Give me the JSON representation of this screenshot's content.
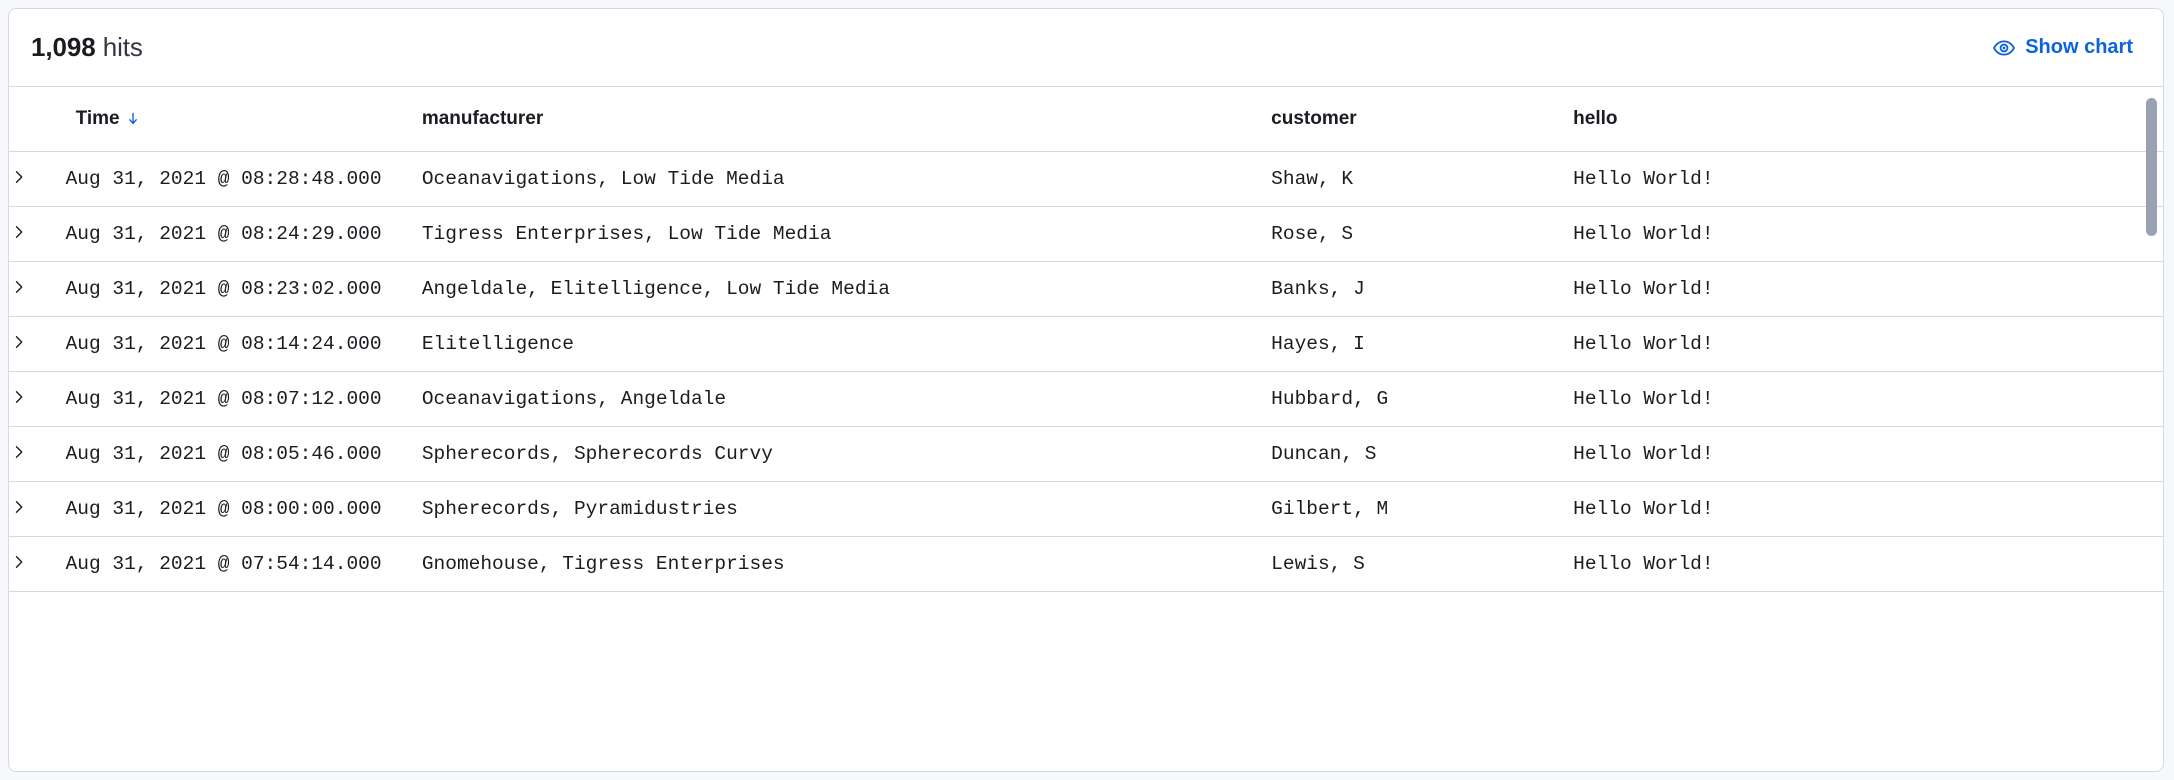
{
  "panel": {
    "hits_count": "1,098",
    "hits_word": "hits",
    "show_chart_label": "Show chart",
    "accent_color": "#0b64dd",
    "border_color": "#d3dae6",
    "text_color": "#1a1c21",
    "eye_icon": "eye-icon",
    "sort_icon": "arrow-down-icon",
    "expand_icon": "chevron-right-icon"
  },
  "table": {
    "columns": [
      {
        "key": "time",
        "label": "Time",
        "sorted": "desc"
      },
      {
        "key": "manufacturer",
        "label": "manufacturer",
        "sorted": ""
      },
      {
        "key": "customer",
        "label": "customer",
        "sorted": ""
      },
      {
        "key": "hello",
        "label": "hello",
        "sorted": ""
      }
    ],
    "rows": [
      {
        "time": "Aug 31, 2021 @ 08:28:48.000",
        "manufacturer": "Oceanavigations, Low Tide Media",
        "customer": "Shaw, K",
        "hello": "Hello World!"
      },
      {
        "time": "Aug 31, 2021 @ 08:24:29.000",
        "manufacturer": "Tigress Enterprises, Low Tide Media",
        "customer": "Rose, S",
        "hello": "Hello World!"
      },
      {
        "time": "Aug 31, 2021 @ 08:23:02.000",
        "manufacturer": "Angeldale, Elitelligence, Low Tide Media",
        "customer": "Banks, J",
        "hello": "Hello World!"
      },
      {
        "time": "Aug 31, 2021 @ 08:14:24.000",
        "manufacturer": "Elitelligence",
        "customer": "Hayes, I",
        "hello": "Hello World!"
      },
      {
        "time": "Aug 31, 2021 @ 08:07:12.000",
        "manufacturer": "Oceanavigations, Angeldale",
        "customer": "Hubbard, G",
        "hello": "Hello World!"
      },
      {
        "time": "Aug 31, 2021 @ 08:05:46.000",
        "manufacturer": "Spherecords, Spherecords Curvy",
        "customer": "Duncan, S",
        "hello": "Hello World!"
      },
      {
        "time": "Aug 31, 2021 @ 08:00:00.000",
        "manufacturer": "Spherecords, Pyramidustries",
        "customer": "Gilbert, M",
        "hello": "Hello World!"
      },
      {
        "time": "Aug 31, 2021 @ 07:54:14.000",
        "manufacturer": "Gnomehouse, Tigress Enterprises",
        "customer": "Lewis, S",
        "hello": "Hello World!"
      }
    ]
  }
}
